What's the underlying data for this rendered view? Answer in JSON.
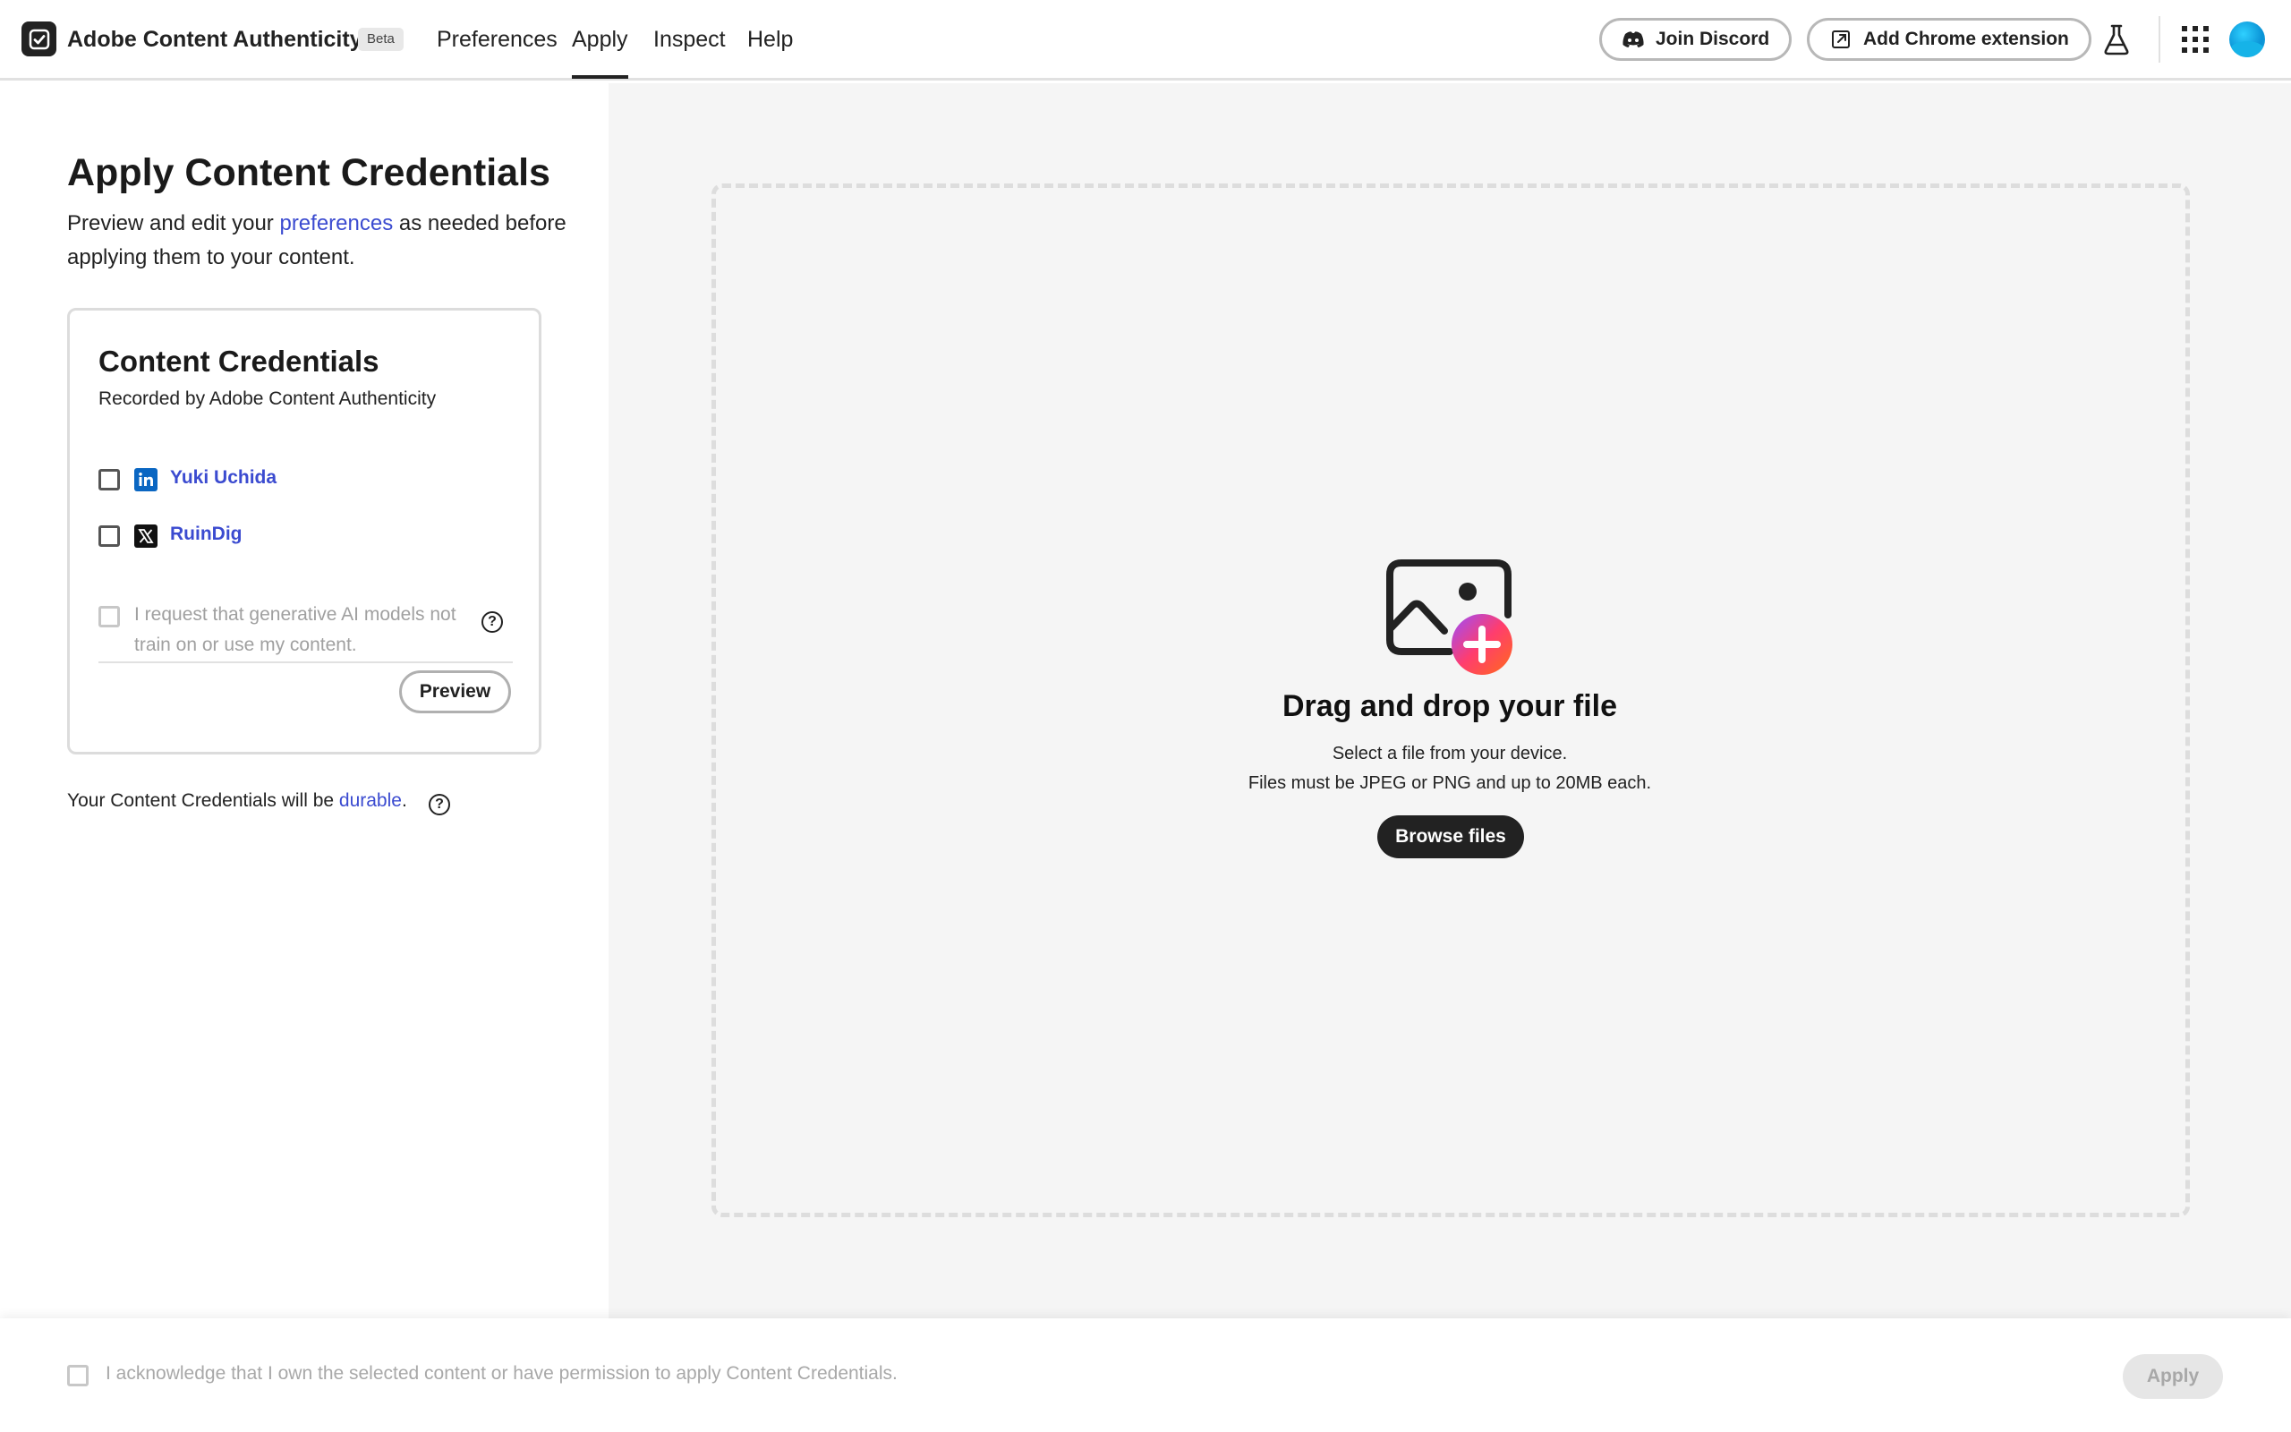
{
  "header": {
    "app_title": "Adobe Content Authenticity",
    "beta_label": "Beta",
    "nav": [
      {
        "label": "Preferences"
      },
      {
        "label": "Apply",
        "active": true
      },
      {
        "label": "Inspect"
      },
      {
        "label": "Help"
      }
    ],
    "join_discord_label": "Join Discord",
    "chrome_extension_label": "Add Chrome extension",
    "icons": [
      "app-logo-icon",
      "discord-icon",
      "external-link-icon",
      "flask-icon",
      "apps-grid-icon",
      "avatar"
    ]
  },
  "left_panel": {
    "title": "Apply Content Credentials",
    "intro_prefix": "Preview and edit your ",
    "intro_link": "preferences",
    "intro_suffix": " as needed before applying them to your content.",
    "card": {
      "title": "Content Credentials",
      "subtitle": "Recorded by Adobe Content Authenticity",
      "accounts": [
        {
          "platform": "linkedin",
          "name": "Yuki Uchida",
          "checked": false
        },
        {
          "platform": "x",
          "name": "RuinDig",
          "checked": false
        }
      ],
      "ai_opt_out_text": "I request that generative AI models not train on or use my content.",
      "preview_label": "Preview"
    },
    "durable_prefix": "Your Content Credentials will be ",
    "durable_link": "durable",
    "durable_suffix": "."
  },
  "drop_zone": {
    "title": "Drag and drop your file",
    "line1": "Select a file from your device.",
    "line2": "Files must be JPEG or PNG and up to 20MB each.",
    "browse_label": "Browse files"
  },
  "footer": {
    "acknowledge_text": "I acknowledge that I own the selected content or have permission to apply Content Credentials.",
    "apply_label": "Apply"
  },
  "colors": {
    "link": "#3b4bd0",
    "dark": "#222222",
    "drop_bg": "#f5f5f5",
    "disabled_text": "#a8a8a8",
    "linkedin": "#0a66c2"
  }
}
